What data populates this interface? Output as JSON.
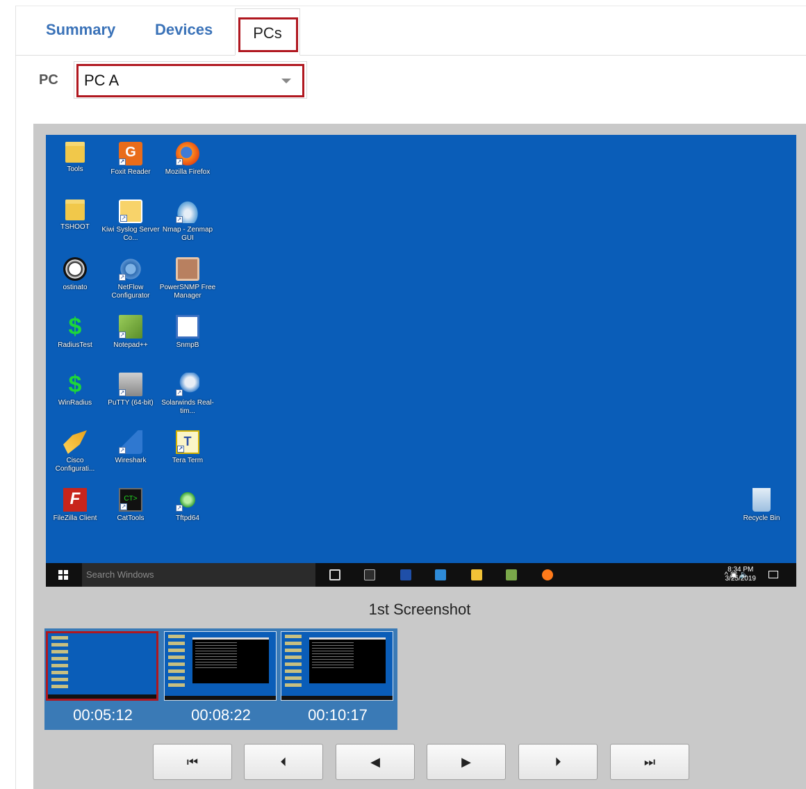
{
  "tabs": {
    "summary": "Summary",
    "devices": "Devices",
    "pcs": "PCs"
  },
  "pc_selector": {
    "label": "PC",
    "value": "PC A"
  },
  "desktop_icons": {
    "tools": "Tools",
    "foxit": "Foxit Reader",
    "firefox": "Mozilla Firefox",
    "tshoot": "TSHOOT",
    "kiwi": "Kiwi Syslog Server Co...",
    "nmap": "Nmap - Zenmap GUI",
    "ostinato": "ostinato",
    "netflow": "NetFlow Configurator",
    "powersnmp": "PowerSNMP Free Manager",
    "radiustest": "RadiusTest",
    "notepad": "Notepad++",
    "snmpb": "SnmpB",
    "winradius": "WinRadius",
    "putty": "PuTTY (64-bit)",
    "solarwinds": "Solarwinds Real-tim...",
    "cisco": "Cisco Configurati...",
    "wireshark": "Wireshark",
    "tera": "Tera Term",
    "filezilla": "FileZilla Client",
    "cattools": "CatTools",
    "tftpd": "Tftpd64",
    "recycle": "Recycle Bin"
  },
  "taskbar": {
    "search_placeholder": "Search Windows",
    "time": "8:34 PM",
    "date": "3/25/2019"
  },
  "caption": "1st Screenshot",
  "thumbnails": [
    {
      "time": "00:05:12"
    },
    {
      "time": "00:08:22"
    },
    {
      "time": "00:10:17"
    }
  ],
  "controls": {
    "first": "⏮",
    "prev_frame": "⏴",
    "rewind": "◀",
    "play": "▶",
    "next_frame": "⏵",
    "last": "⏭"
  },
  "colors": {
    "accent_red": "#b0171f",
    "tab_blue": "#3a72b8",
    "desktop_blue": "#0a5db8"
  }
}
